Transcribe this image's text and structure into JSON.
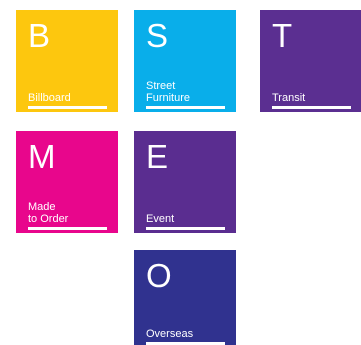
{
  "tiles": [
    {
      "letter": "B",
      "label": "Billboard",
      "color": "#fdc70e"
    },
    {
      "letter": "S",
      "label": "Street\nFurniture",
      "color": "#09aeea"
    },
    {
      "letter": "T",
      "label": "Transit",
      "color": "#5b2f91"
    },
    {
      "letter": "M",
      "label": "Made\nto Order",
      "color": "#e8068c"
    },
    {
      "letter": "E",
      "label": "Event",
      "color": "#5a2d90"
    },
    {
      "letter": "O",
      "label": "Overseas",
      "color": "#30328f"
    }
  ]
}
